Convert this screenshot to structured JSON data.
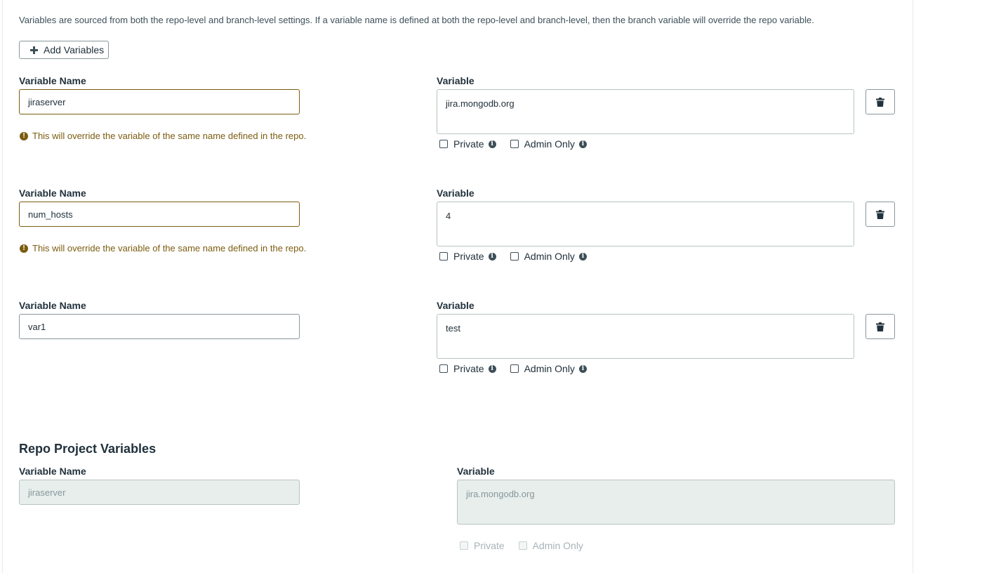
{
  "intro_text": "Variables are sourced from both the repo-level and branch-level settings. If a variable name is defined at both the repo-level and branch-level, then the branch variable will override the repo variable.",
  "add_button_label": "Add Variables",
  "field_labels": {
    "name": "Variable Name",
    "value": "Variable"
  },
  "checkbox_labels": {
    "private": "Private",
    "admin_only": "Admin Only"
  },
  "warning_text": "This will override the variable of the same name defined in the repo.",
  "branch_variables": [
    {
      "name": "jiraserver",
      "value": "jira.mongodb.org",
      "override_warning": true,
      "private": false,
      "admin_only": false
    },
    {
      "name": "num_hosts",
      "value": "4",
      "override_warning": true,
      "private": false,
      "admin_only": false
    },
    {
      "name": "var1",
      "value": "test",
      "override_warning": false,
      "private": false,
      "admin_only": false
    }
  ],
  "repo_section": {
    "title": "Repo Project Variables",
    "variables": [
      {
        "name": "jiraserver",
        "value": "jira.mongodb.org",
        "private": false,
        "admin_only": false
      }
    ]
  },
  "icons": {
    "add": "plus-icon",
    "delete": "trash-icon",
    "warning": "exclamation-circle-icon",
    "info": "info-circle-icon"
  },
  "colors": {
    "warning": "#7c5c10",
    "border": "#89979b",
    "disabled_bg": "#e7eeec",
    "text": "#21313c"
  }
}
